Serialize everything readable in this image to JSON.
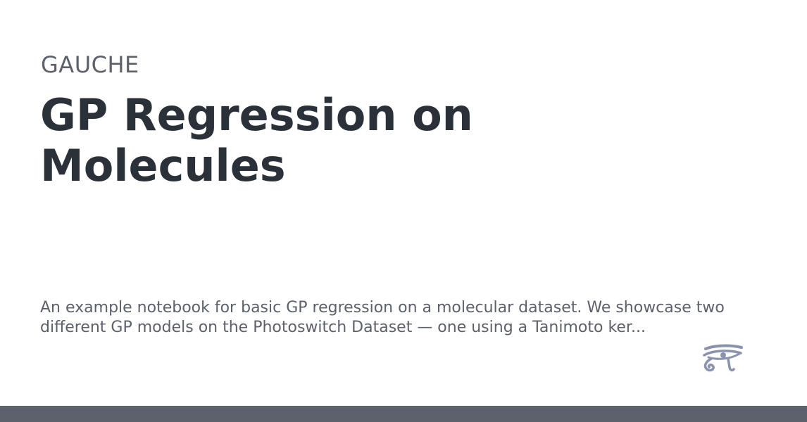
{
  "site": {
    "name": "GAUCHE"
  },
  "page": {
    "title": "GP Regression on Molecules",
    "description": "An example notebook for basic GP regression on a molecular dataset. We showcase two different GP models on the Photoswitch Dataset — one using a Tanimoto ker..."
  },
  "logo": {
    "icon": "eye-of-horus-icon",
    "color": "#8a93ad"
  },
  "theme": {
    "footer_color": "#5c616c"
  }
}
